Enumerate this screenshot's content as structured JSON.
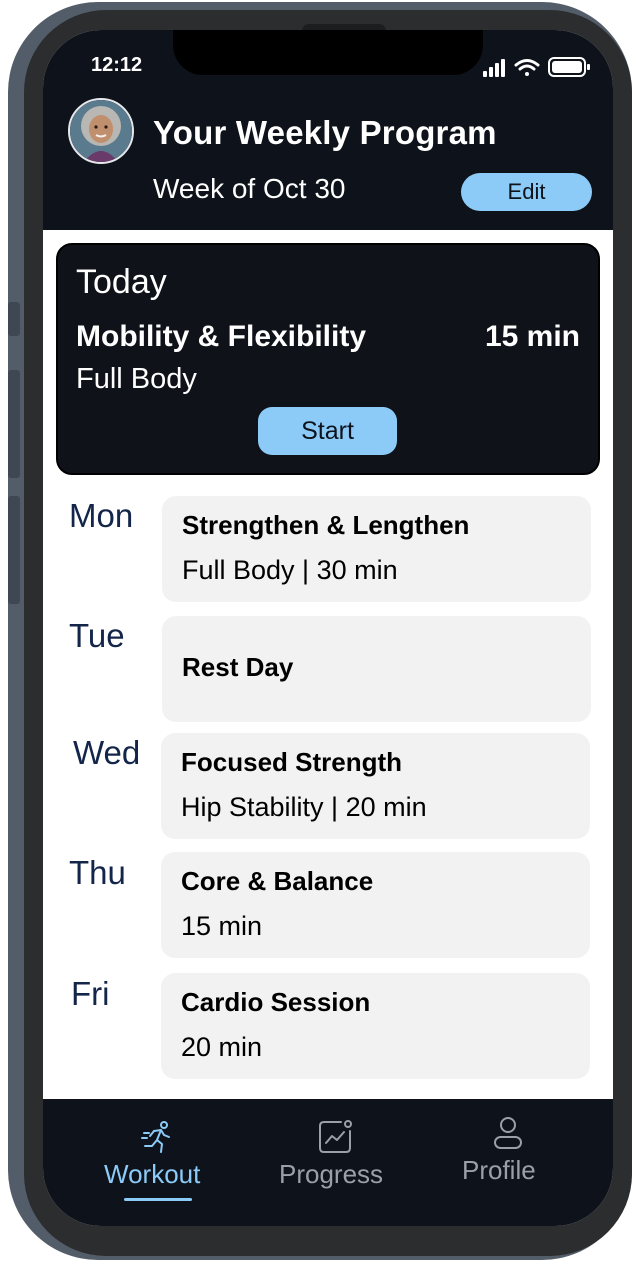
{
  "status_bar": {
    "time": "12:12",
    "icons": [
      "signal-icon",
      "wifi-icon",
      "battery-icon"
    ]
  },
  "header": {
    "title": "Your Weekly Program",
    "week": "Week of Oct 30",
    "edit_label": "Edit",
    "avatar": "user-avatar"
  },
  "today": {
    "heading": "Today",
    "title": "Mobility & Flexibility",
    "duration": "15 min",
    "subtitle": "Full Body",
    "start_label": "Start"
  },
  "schedule": [
    {
      "day": "Mon",
      "title": "Strengthen & Lengthen",
      "detail": "Full Body | 30 min"
    },
    {
      "day": "Tue",
      "title": "Rest Day",
      "detail": ""
    },
    {
      "day": "Wed",
      "title": "Focused Strength",
      "detail": "Hip Stability | 20 min"
    },
    {
      "day": "Thu",
      "title": "Core & Balance",
      "detail": "15 min"
    },
    {
      "day": "Fri",
      "title": "Cardio Session",
      "detail": "20 min"
    }
  ],
  "nav": {
    "items": [
      {
        "label": "Workout",
        "icon": "running-person-icon",
        "active": true
      },
      {
        "label": "Progress",
        "icon": "chart-icon",
        "active": false
      },
      {
        "label": "Profile",
        "icon": "person-icon",
        "active": false
      }
    ]
  },
  "colors": {
    "accent": "#8ccbf7",
    "header_bg": "#0e121a",
    "day_label": "#14254a",
    "card_bg": "#f2f2f2",
    "nav_inactive": "#9aa0a8"
  }
}
